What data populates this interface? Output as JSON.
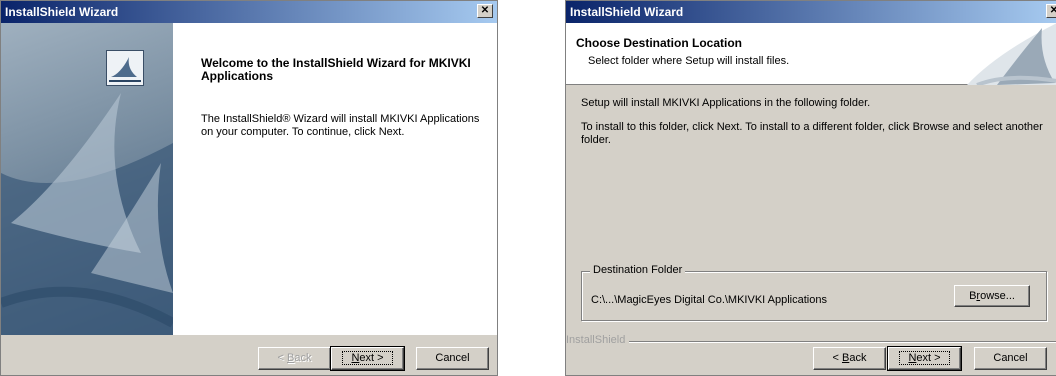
{
  "window1": {
    "title": "InstallShield Wizard",
    "close_glyph": "✕",
    "heading": "Welcome to the InstallShield Wizard for MKIVKI Applications",
    "body": "The InstallShield® Wizard will install MKIVKI Applications on your computer.  To continue, click Next.",
    "buttons": {
      "back_prefix": "< ",
      "back_mnemonic": "B",
      "back_rest": "ack",
      "next_mnemonic": "N",
      "next_rest": "ext >",
      "cancel": "Cancel"
    }
  },
  "window2": {
    "title": "InstallShield Wizard",
    "close_glyph": "✕",
    "header_title": "Choose Destination Location",
    "header_subtitle": "Select folder where Setup will install files.",
    "line1": "Setup will install MKIVKI Applications in the following folder.",
    "line2": "To install to this folder, click Next. To install to a different folder, click Browse and select another folder.",
    "group_label": "Destination Folder",
    "path": "C:\\...\\MagicEyes Digital Co.\\MKIVKI Applications",
    "browse_mnemonic": "r",
    "browse_pre": "B",
    "browse_post": "owse...",
    "brand": "InstallShield",
    "buttons": {
      "back_prefix": "< ",
      "back_mnemonic": "B",
      "back_rest": "ack",
      "next_mnemonic": "N",
      "next_rest": "ext >",
      "cancel": "Cancel"
    }
  },
  "colors": {
    "titlebar_start": "#0a246a",
    "titlebar_end": "#a6caf0",
    "dialog_bg": "#d4d0c8"
  }
}
